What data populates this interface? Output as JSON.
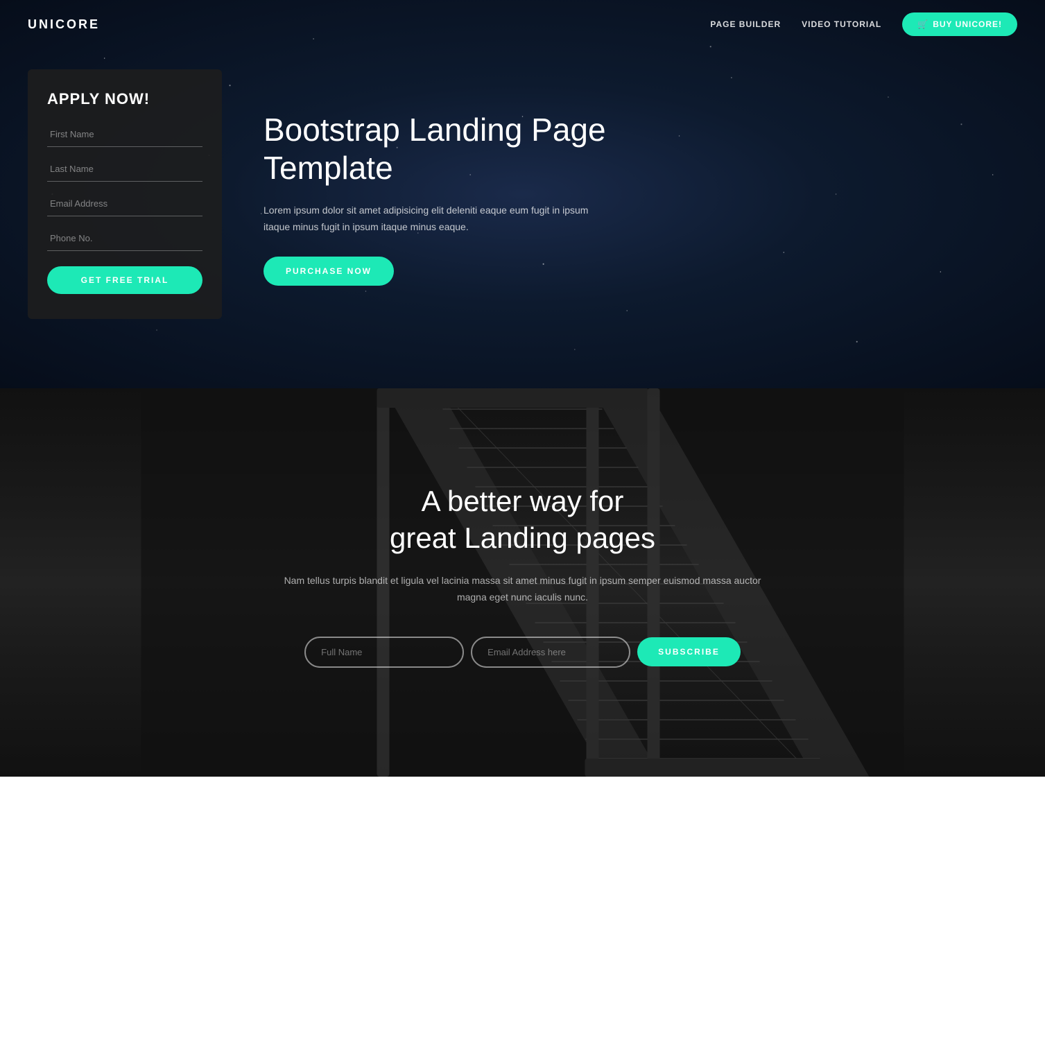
{
  "brand": "UNICORE",
  "nav": {
    "links": [
      {
        "label": "PAGE BUILDER",
        "id": "page-builder-link"
      },
      {
        "label": "VIDEO TUTORIAL",
        "id": "video-tutorial-link"
      }
    ],
    "cta_label": "BUY UNICORE!",
    "cta_icon": "cart-icon"
  },
  "hero": {
    "form": {
      "title": "APPLY NOW!",
      "fields": [
        {
          "placeholder": "First Name",
          "type": "text",
          "id": "first-name-field"
        },
        {
          "placeholder": "Last Name",
          "type": "text",
          "id": "last-name-field"
        },
        {
          "placeholder": "Email Address",
          "type": "email",
          "id": "email-field"
        },
        {
          "placeholder": "Phone No.",
          "type": "tel",
          "id": "phone-field"
        }
      ],
      "submit_label": "GET FREE TRIAL"
    },
    "heading": "Bootstrap Landing Page\nTemplate",
    "description": "Lorem ipsum dolor sit amet adipisicing elit deleniti eaque eum fugit in ipsum itaque minus fugit in ipsum itaque minus eaque.",
    "cta_label": "PURCHASE NOW"
  },
  "section2": {
    "heading_line1": "A better way for",
    "heading_line2": "great Landing pages",
    "description": "Nam tellus turpis blandit et ligula vel lacinia massa sit amet minus fugit in ipsum semper euismod massa auctor magna eget nunc iaculis nunc.",
    "subscribe": {
      "fullname_placeholder": "Full Name",
      "email_placeholder": "Email Address here",
      "button_label": "SUBSCRIBE"
    }
  },
  "colors": {
    "accent": "#1de9b6",
    "hero_bg_dark": "#0d1a2e",
    "section2_bg": "#1a1a1a",
    "text_white": "#ffffff",
    "text_muted": "rgba(255,255,255,0.65)"
  }
}
